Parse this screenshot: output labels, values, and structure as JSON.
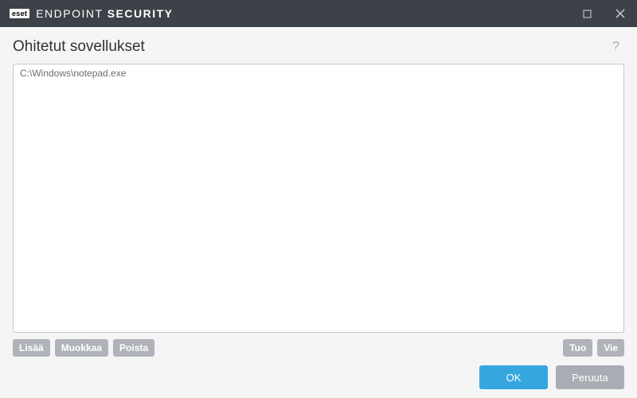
{
  "titlebar": {
    "badge": "eset",
    "name_light": "ENDPOINT",
    "name_strong": "SECURITY"
  },
  "page": {
    "title": "Ohitetut sovellukset"
  },
  "list": {
    "items": [
      "C:\\Windows\\notepad.exe"
    ]
  },
  "toolbar": {
    "add": "Lisää",
    "edit": "Muokkaa",
    "remove": "Poista",
    "import": "Tuo",
    "export": "Vie"
  },
  "footer": {
    "ok": "OK",
    "cancel": "Peruuta"
  }
}
